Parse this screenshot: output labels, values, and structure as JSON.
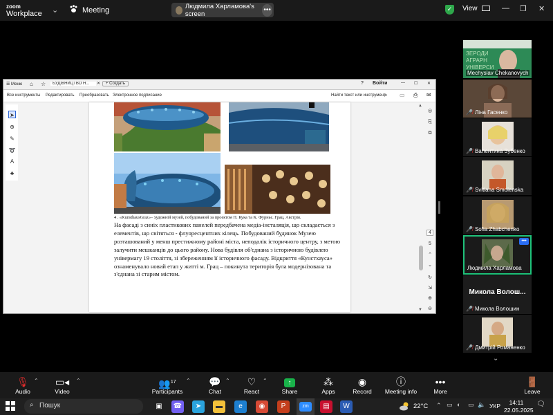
{
  "zoom": {
    "brand_top": "zoom",
    "brand_bottom": "Workplace",
    "meeting_label": "Meeting",
    "share_label": "Людмила Харламова's screen",
    "view_label": "View"
  },
  "acrobat": {
    "menu": "Меню",
    "tab_title": "БУДІВНИЦТВО Н...",
    "create": "Создать",
    "signin": "Войти",
    "toolbar": [
      "Все инструменты",
      "Редактировать",
      "Преобразовать",
      "Электронное подписание"
    ],
    "search": "Найти текст или инструмент",
    "page_current": "4",
    "page_total": "5"
  },
  "document": {
    "caption": "4 . «KunsthausGraz»– художній музей, побудований за проектом П. Кука та К. Фурньє. Грац, Австрія.",
    "paragraph": "На фасаді з синіх пластикових панелей передбачена медіа-інсталяція, що складається з елементів, що світяться - флуоресцентних кілець. Побудований будинок Музею розташований у менш престижному районі міста, неподалік історичного центру, з метою залучити мешканців до цього району. Нова будівля об'єднана з історичною будівлею універмагу 19 століття, зі збереженням її історичного фасаду. Відкриття «Кунстхауса» ознаменувало новий етап у житті м. Грац – покинута територія була модернізована та з'єднана зі старим містом."
  },
  "participants": [
    {
      "name": "Mechyslav Chekanovych",
      "muted": false,
      "video": true
    },
    {
      "name": "Ліна Гасенко",
      "muted": true,
      "video": true
    },
    {
      "name": "Валентина Зубенко",
      "muted": true,
      "video": true
    },
    {
      "name": "Svitlana Smolenska",
      "muted": true,
      "video": true
    },
    {
      "name": "Sofia Zhabchenko",
      "muted": true,
      "video": true
    },
    {
      "name": "Людмила Харламова",
      "muted": false,
      "video": true,
      "active": true
    },
    {
      "name": "Микола Волошин",
      "muted": true,
      "video": false,
      "display_name": "Микола Волош..."
    },
    {
      "name": "Дмитрій Романенко",
      "muted": true,
      "video": true
    }
  ],
  "toolbar": {
    "audio": "Audio",
    "video": "Video",
    "participants": "Participants",
    "participants_count": "17",
    "chat": "Chat",
    "react": "React",
    "share": "Share",
    "apps": "Apps",
    "record": "Record",
    "meeting_info": "Meeting info",
    "more": "More",
    "leave": "Leave"
  },
  "taskbar": {
    "search": "Пошук",
    "weather": "22°C",
    "lang": "УКР",
    "time": "14:11",
    "date": "22.05.2025"
  },
  "colors": {
    "zoom_green": "#1fc37b",
    "share_green": "#19b24a",
    "mute_red": "#e02c2c",
    "leave_red": "#e02c2c"
  }
}
